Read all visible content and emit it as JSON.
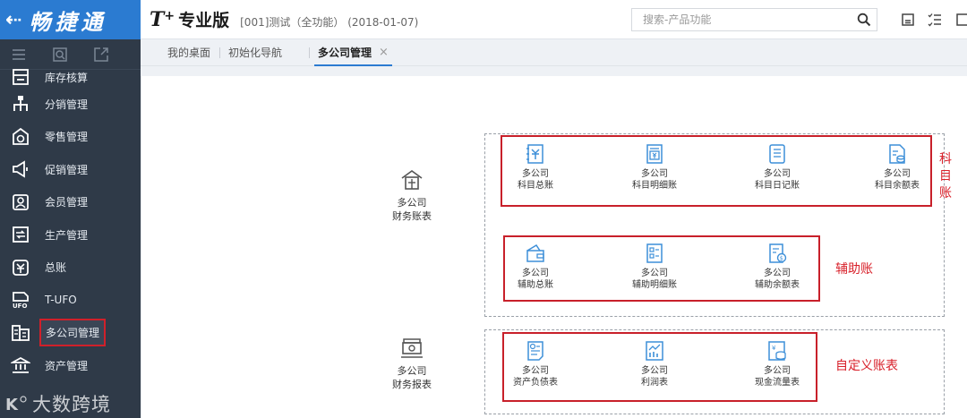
{
  "brand": {
    "back_icon": "back-arrow-icon",
    "name": "畅捷通"
  },
  "header": {
    "logo_t": "T",
    "logo_plus": "+",
    "edition": "专业版",
    "account_info": "[001]测试（全功能） (2018-01-07)",
    "search_placeholder": "搜索-产品功能"
  },
  "sidebar": {
    "items": [
      {
        "label": "库存核算",
        "icon": "inventory-icon"
      },
      {
        "label": "分销管理",
        "icon": "distribution-icon"
      },
      {
        "label": "零售管理",
        "icon": "retail-icon"
      },
      {
        "label": "促销管理",
        "icon": "promotion-icon"
      },
      {
        "label": "会员管理",
        "icon": "member-icon"
      },
      {
        "label": "生产管理",
        "icon": "production-icon"
      },
      {
        "label": "总账",
        "icon": "ledger-icon"
      },
      {
        "label": "T-UFO",
        "icon": "ufo-icon"
      },
      {
        "label": "多公司管理",
        "icon": "multi-company-icon"
      },
      {
        "label": "资产管理",
        "icon": "asset-icon"
      }
    ],
    "watermark": "大数跨境"
  },
  "tabs": [
    {
      "label": "我的桌面"
    },
    {
      "label": "初始化导航"
    },
    {
      "label": "多公司管理",
      "close": "×"
    }
  ],
  "content": {
    "group_ledger": {
      "line1": "多公司",
      "line2": "财务账表"
    },
    "group_reports": {
      "line1": "多公司",
      "line2": "财务报表"
    },
    "subject_tiles": [
      {
        "line1": "多公司",
        "line2": "科目总账"
      },
      {
        "line1": "多公司",
        "line2": "科目明细账"
      },
      {
        "line1": "多公司",
        "line2": "科目日记账"
      },
      {
        "line1": "多公司",
        "line2": "科目余额表"
      }
    ],
    "aux_tiles": [
      {
        "line1": "多公司",
        "line2": "辅助总账"
      },
      {
        "line1": "多公司",
        "line2": "辅助明细账"
      },
      {
        "line1": "多公司",
        "line2": "辅助余额表"
      }
    ],
    "report_tiles": [
      {
        "line1": "多公司",
        "line2": "资产负债表"
      },
      {
        "line1": "多公司",
        "line2": "利润表"
      },
      {
        "line1": "多公司",
        "line2": "现金流量表"
      }
    ],
    "note_subject": "科目账",
    "note_aux": "辅助账",
    "note_custom": "自定义账表"
  },
  "colors": {
    "brand_blue": "#2b7bd1",
    "sidebar_bg": "#2f3a48",
    "highlight_red": "#c8202a",
    "icon_blue": "#3d8fd8"
  }
}
